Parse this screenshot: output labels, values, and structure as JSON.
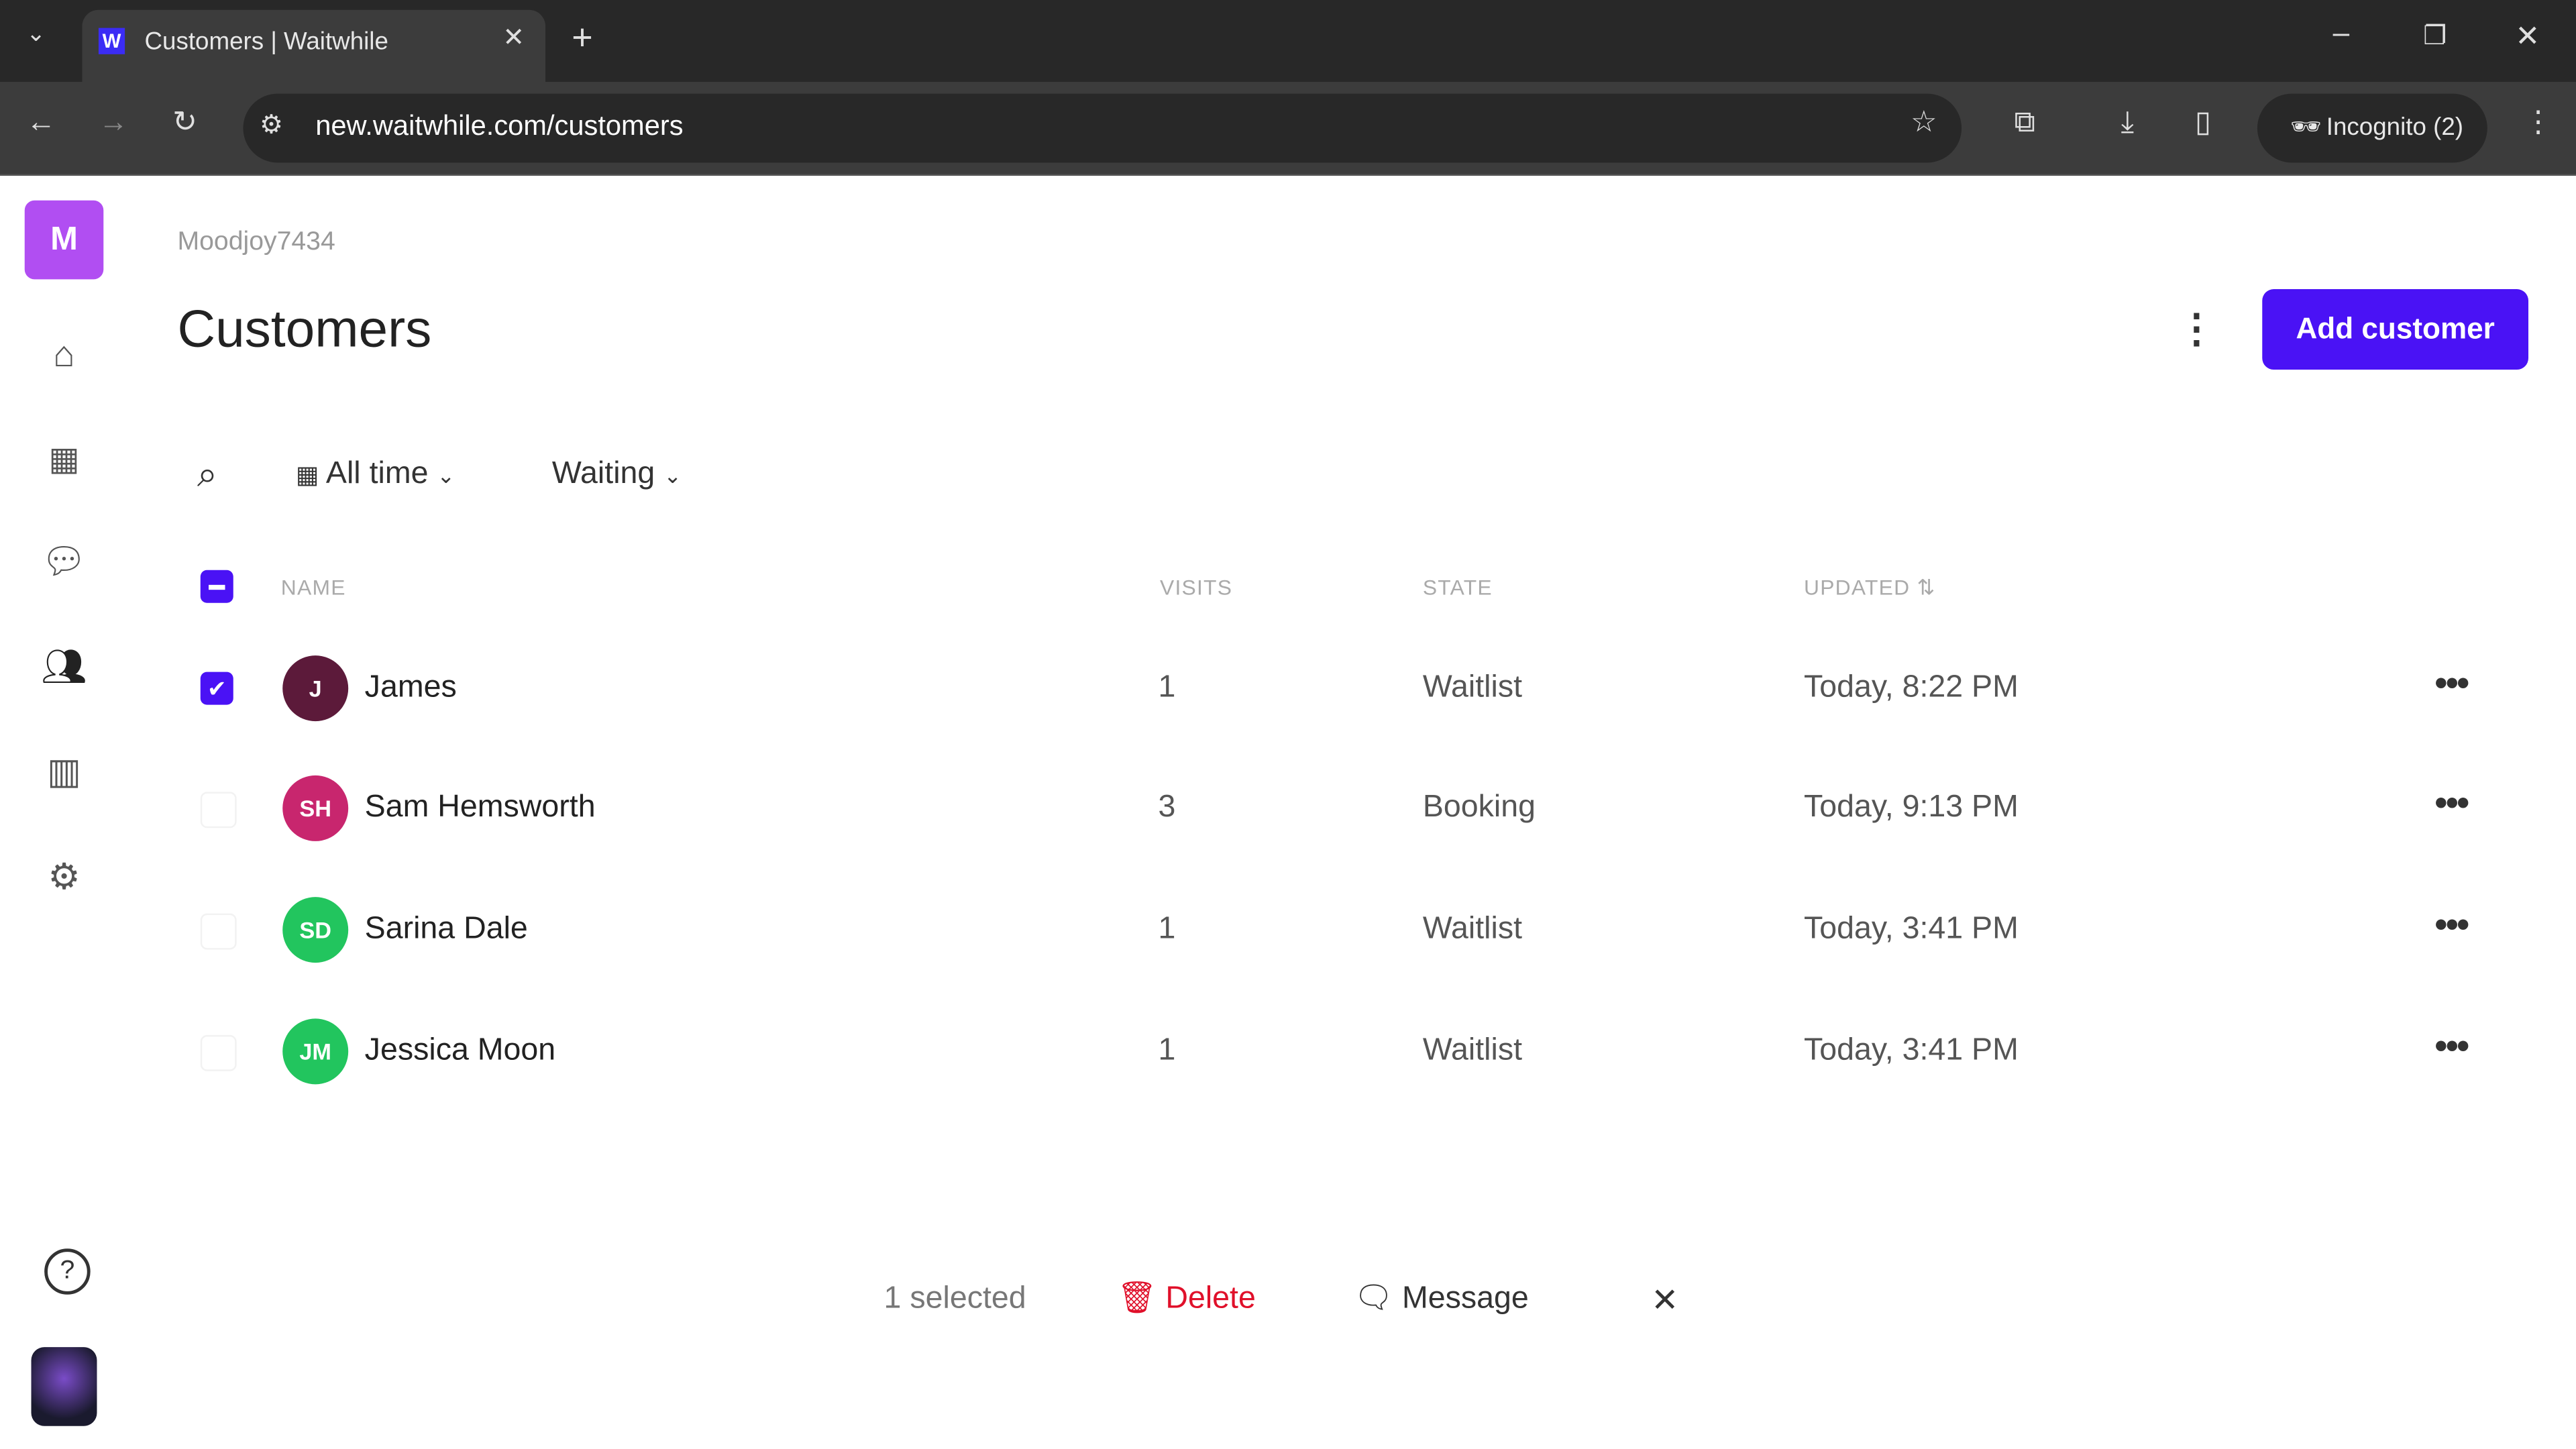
{
  "browser": {
    "tab_title": "Customers | Waitwhile",
    "url": "new.waitwhile.com/customers",
    "incognito": "Incognito (2)",
    "favicon": "W"
  },
  "sidebar": {
    "workspace_initial": "M",
    "items": [
      "home-icon",
      "calendar-icon",
      "chat-icon",
      "customers-icon",
      "analytics-icon",
      "settings-icon"
    ],
    "help": "help-icon"
  },
  "header": {
    "workspace": "Moodjoy7434",
    "title": "Customers",
    "add_button": "Add customer"
  },
  "filters": {
    "date": "All time",
    "state": "Waiting"
  },
  "table": {
    "columns": [
      "NAME",
      "VISITS",
      "STATE",
      "UPDATED"
    ],
    "rows": [
      {
        "initials": "J",
        "name": "James",
        "visits": "1",
        "state": "Waitlist",
        "updated": "Today, 8:22 PM",
        "checked": true,
        "color": "#5c1a3a"
      },
      {
        "initials": "SH",
        "name": "Sam Hemsworth",
        "visits": "3",
        "state": "Booking",
        "updated": "Today, 9:13 PM",
        "checked": false,
        "color": "#c8266e"
      },
      {
        "initials": "SD",
        "name": "Sarina Dale",
        "visits": "1",
        "state": "Waitlist",
        "updated": "Today, 3:41 PM",
        "checked": false,
        "color": "#22c55e"
      },
      {
        "initials": "JM",
        "name": "Jessica Moon",
        "visits": "1",
        "state": "Waitlist",
        "updated": "Today, 3:41 PM",
        "checked": false,
        "color": "#22c55e"
      }
    ]
  },
  "selection_bar": {
    "count": "1 selected",
    "delete": "Delete",
    "message": "Message"
  },
  "colors": {
    "accent": "#4a12f5",
    "danger": "#e0102a"
  }
}
